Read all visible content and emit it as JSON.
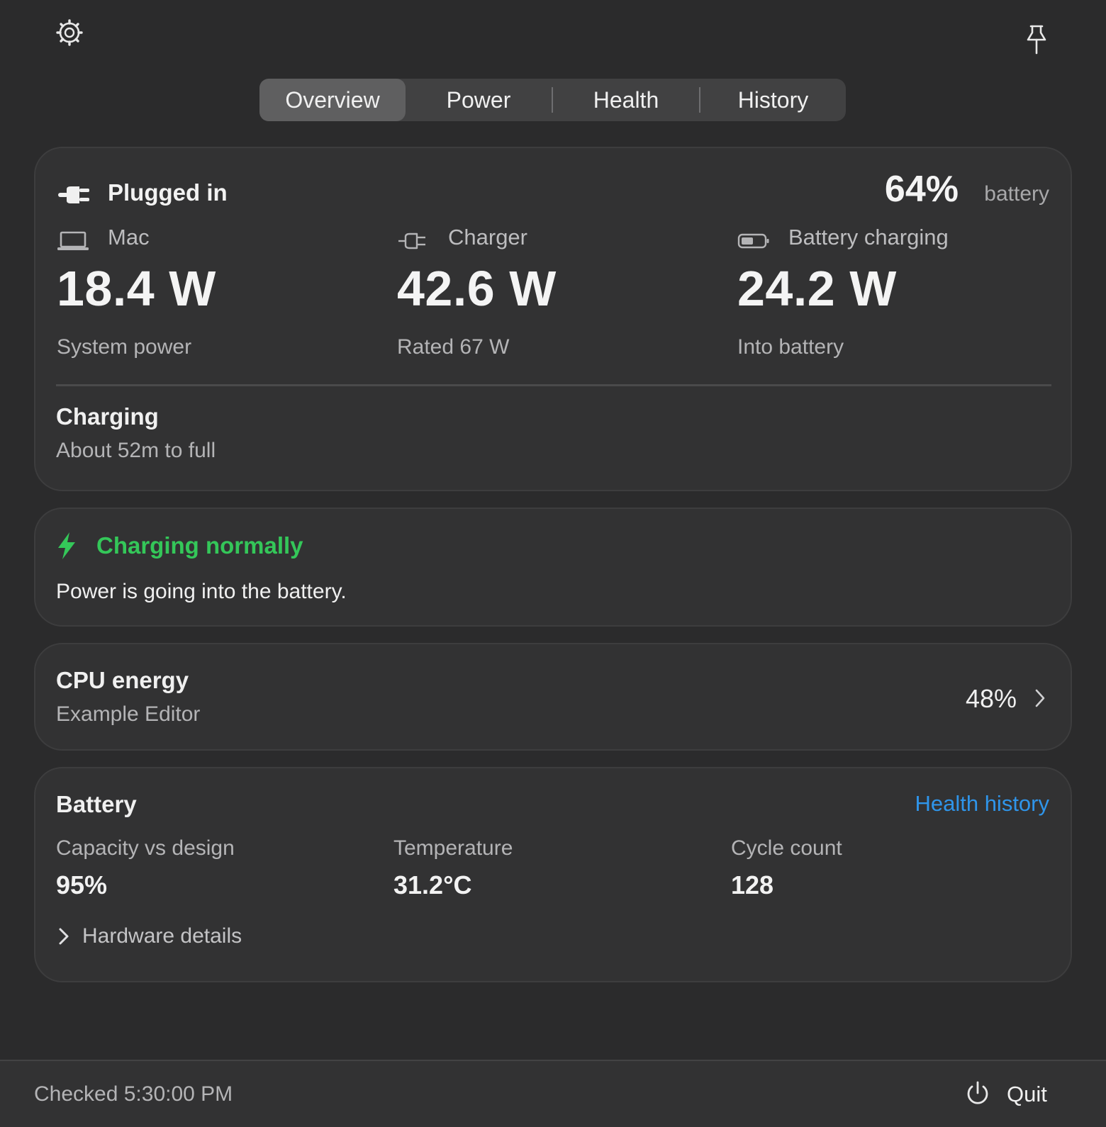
{
  "header": {
    "settings_icon": "gear-icon",
    "pin_icon": "pin-icon"
  },
  "tabs": [
    {
      "label": "Overview",
      "selected": true
    },
    {
      "label": "Power",
      "selected": false
    },
    {
      "label": "Health",
      "selected": false
    },
    {
      "label": "History",
      "selected": false
    }
  ],
  "summary": {
    "state_icon": "plug-icon",
    "state_label": "Plugged in",
    "battery_percent": "64%",
    "battery_percent_unit": "battery",
    "columns": [
      {
        "icon": "laptop-icon",
        "label": "Mac",
        "value": "18.4 W",
        "sub": "System power"
      },
      {
        "icon": "charger-icon",
        "label": "Charger",
        "value": "42.6 W",
        "sub": "Rated 67 W"
      },
      {
        "icon": "battery-icon",
        "label": "Battery charging",
        "value": "24.2 W",
        "sub": "Into battery"
      }
    ],
    "charging_title": "Charging",
    "charging_sub": "About 52m to full"
  },
  "status": {
    "icon": "bolt-icon",
    "title": "Charging normally",
    "title_color": "#34c759",
    "description": "Power is going into the battery."
  },
  "cpu": {
    "title": "CPU energy",
    "app": "Example Editor",
    "percent": "48%",
    "chevron_icon": "chevron-right-icon"
  },
  "battery": {
    "title": "Battery",
    "link": "Health history",
    "link_color": "#2f95ea",
    "stats": [
      {
        "label": "Capacity vs design",
        "value": "95%"
      },
      {
        "label": "Temperature",
        "value": "31.2°C"
      },
      {
        "label": "Cycle count",
        "value": "128"
      }
    ],
    "hardware_label": "Hardware details"
  },
  "footer": {
    "checked": "Checked 5:30:00 PM",
    "power_icon": "power-icon",
    "quit_label": "Quit"
  }
}
